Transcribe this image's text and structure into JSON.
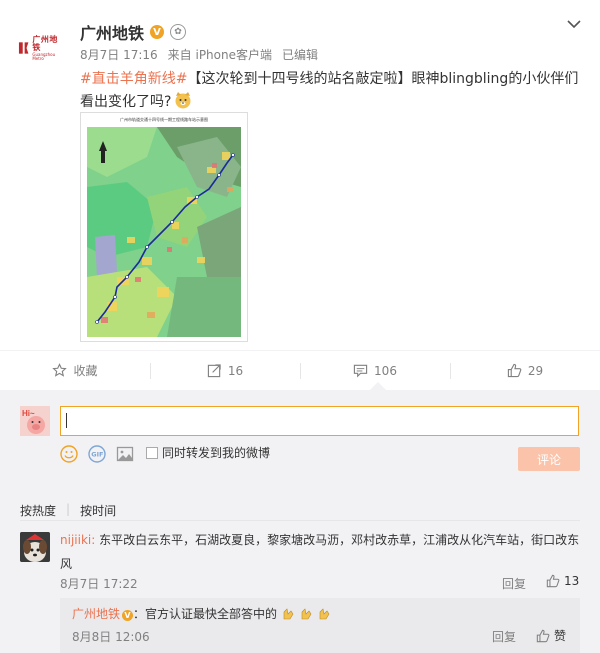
{
  "post": {
    "author": "广州地铁",
    "meta_time": "8月7日 17:16",
    "meta_source": "来自 iPhone客户端",
    "meta_edited": "已编辑",
    "topic": "#直击羊角新线#",
    "text": "【这次轮到十四号线的站名敲定啦】眼神blingbling的小伙伴们看出变化了吗?",
    "image_title": "广州市轨道交通十四号线一期工程线路车站示意图"
  },
  "logo": {
    "cn": "广州地铁",
    "en": "Guangzhou Metro"
  },
  "actions": {
    "favorite": "收藏",
    "repost_count": "16",
    "comment_count": "106",
    "like_count": "29"
  },
  "composer": {
    "repost_label": "同时转发到我的微博",
    "submit_label": "评论",
    "avatar_text": "Hi~"
  },
  "sort": {
    "hot": "按热度",
    "time": "按时间"
  },
  "comment": {
    "user": "nijiiki:",
    "text": "东平改白云东平，石湖改夏良，黎家塘改马沥，邓村改赤草，江浦改从化汽车站，街口改东风",
    "time": "8月7日 17:22",
    "reply": "回复",
    "likes": "13"
  },
  "sub_comment": {
    "user": "广州地铁",
    "text": "：官方认证最快全部答中的",
    "time": "8月8日 12:06",
    "reply": "回复",
    "like": "赞"
  },
  "colors": {
    "accent": "#eb7350",
    "verified": "#f0a325",
    "submit_bg": "#fbc3a9"
  }
}
